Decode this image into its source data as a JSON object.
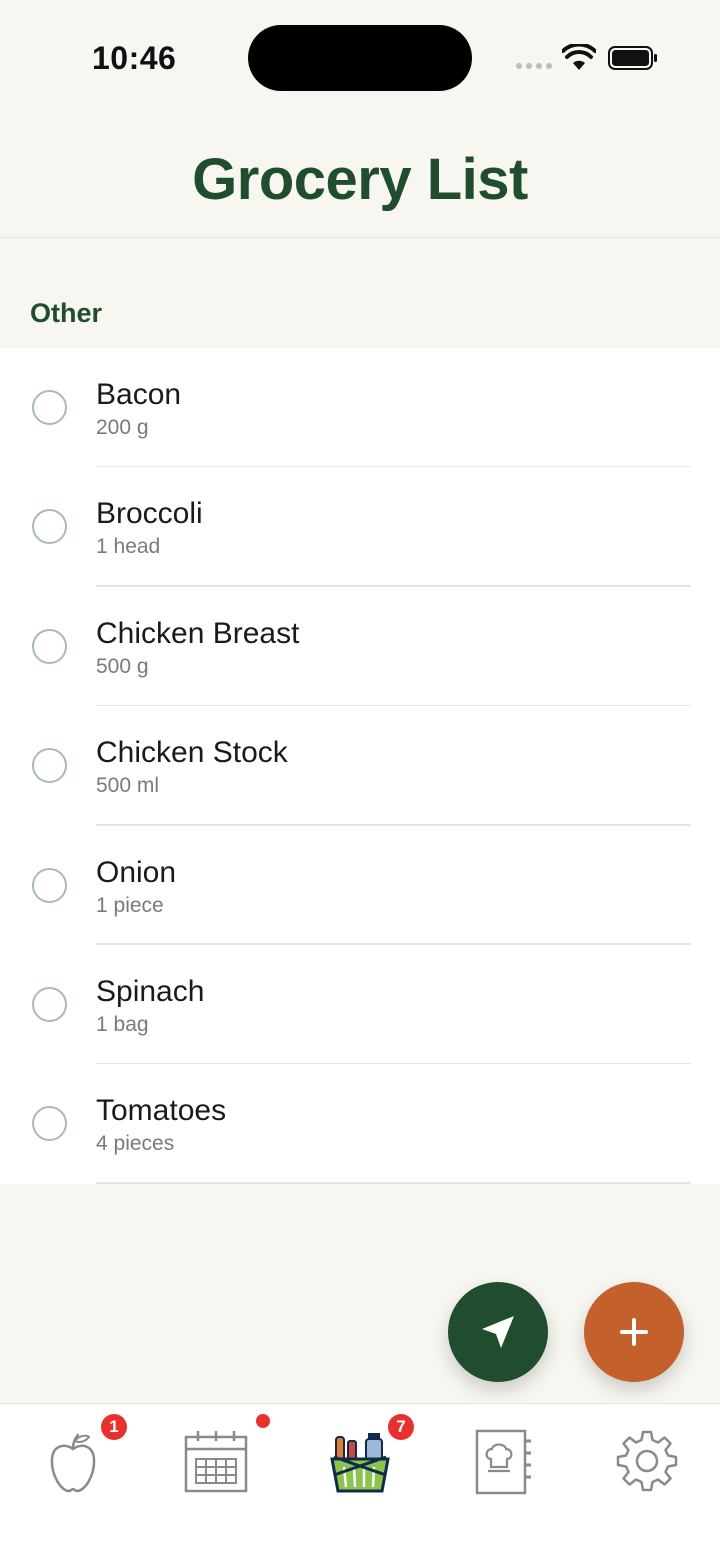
{
  "status_bar": {
    "time": "10:46"
  },
  "header": {
    "title": "Grocery List"
  },
  "section": {
    "label": "Other"
  },
  "items": [
    {
      "name": "Bacon",
      "qty": "200 g"
    },
    {
      "name": "Broccoli",
      "qty": "1 head"
    },
    {
      "name": "Chicken Breast",
      "qty": "500 g"
    },
    {
      "name": "Chicken Stock",
      "qty": "500 ml"
    },
    {
      "name": "Onion",
      "qty": "1 piece"
    },
    {
      "name": "Spinach",
      "qty": "1 bag"
    },
    {
      "name": "Tomatoes",
      "qty": "4 pieces"
    }
  ],
  "fabs": {
    "navigate_icon": "location-arrow-icon",
    "add_icon": "plus-icon"
  },
  "tabbar": {
    "tabs": [
      {
        "icon": "apple-icon",
        "badge": "1"
      },
      {
        "icon": "calendar-icon",
        "badge_dot": true
      },
      {
        "icon": "grocery-basket-icon",
        "badge": "7",
        "active": true
      },
      {
        "icon": "recipe-book-icon"
      },
      {
        "icon": "gear-icon"
      }
    ]
  },
  "colors": {
    "brand_green": "#1f4d2e",
    "accent_orange": "#c4602c",
    "badge_red": "#e8312f",
    "background": "#f8f6f1"
  }
}
